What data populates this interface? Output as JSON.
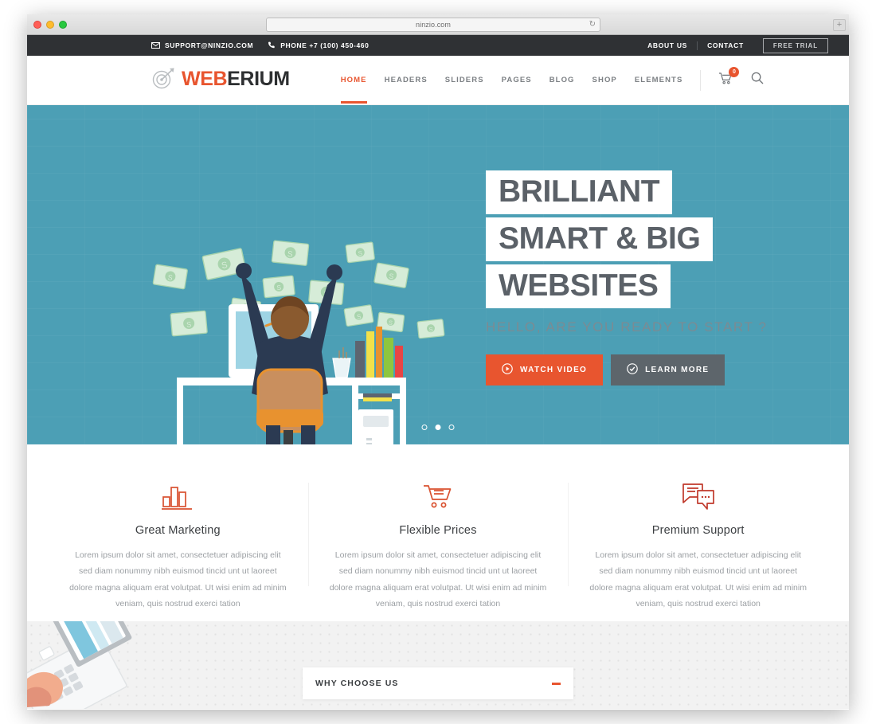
{
  "browser": {
    "url": "ninzio.com",
    "reload_icon": "reload-icon",
    "newtab_label": "+",
    "traffic_lights": [
      "close",
      "minimize",
      "maximize"
    ]
  },
  "topbar": {
    "email": "SUPPORT@NINZIO.COM",
    "email_icon": "envelope-icon",
    "phone": "PHONE +7 (100) 450-460",
    "phone_icon": "phone-icon",
    "links": [
      {
        "label": "ABOUT US"
      },
      {
        "label": "CONTACT"
      }
    ],
    "cta": "FREE TRIAL",
    "background": "#2f3134"
  },
  "header": {
    "logo": {
      "icon": "target-dart-icon",
      "text_part1": "WEB",
      "text_part2": "ERIUM",
      "color1": "#e8552f",
      "color2": "#2d2f31",
      "underline_color": "#bfe0e2"
    },
    "nav": [
      {
        "label": "HOME",
        "active": true
      },
      {
        "label": "HEADERS",
        "active": false
      },
      {
        "label": "SLIDERS",
        "active": false
      },
      {
        "label": "PAGES",
        "active": false
      },
      {
        "label": "BLOG",
        "active": false
      },
      {
        "label": "SHOP",
        "active": false
      },
      {
        "label": "ELEMENTS",
        "active": false
      }
    ],
    "cart_icon": "shopping-cart-icon",
    "cart_count": "0",
    "search_icon": "search-icon",
    "accent": "#e8552f"
  },
  "hero": {
    "headline_line1": "BRILLIANT",
    "headline_line2": "SMART & BIG",
    "headline_line3": "WEBSITES",
    "subtitle": "HELLO, ARE YOU READY TO START ?",
    "buttons": [
      {
        "label": "WATCH VIDEO",
        "icon": "play-circle-icon",
        "style": "primary"
      },
      {
        "label": "LEARN MORE",
        "icon": "check-circle-icon",
        "style": "secondary"
      }
    ],
    "background": "#4c9fb5",
    "slides": [
      {
        "active": false
      },
      {
        "active": true
      },
      {
        "active": false
      }
    ],
    "illustration": "businessman-money-desk-illustration"
  },
  "features": [
    {
      "icon": "bar-chart-icon",
      "title": "Great Marketing",
      "text": "Lorem ipsum dolor sit amet, consectetuer adipiscing elit sed diam nonummy nibh euismod tincid unt ut laoreet dolore magna aliquam erat volutpat. Ut wisi enim ad minim veniam, quis nostrud exerci tation"
    },
    {
      "icon": "shopping-cart-icon",
      "title": "Flexible Prices",
      "text": "Lorem ipsum dolor sit amet, consectetuer adipiscing elit sed diam nonummy nibh euismod tincid unt ut laoreet dolore magna aliquam erat volutpat. Ut wisi enim ad minim veniam, quis nostrud exerci tation"
    },
    {
      "icon": "chat-bubbles-icon",
      "title": "Premium Support",
      "text": "Lorem ipsum dolor sit amet, consectetuer adipiscing elit sed diam nonummy nibh euismod tincid unt ut laoreet dolore magna aliquam erat volutpat. Ut wisi enim ad minim veniam, quis nostrud exerci tation"
    }
  ],
  "why_section": {
    "accordion_title": "WHY CHOOSE US",
    "toggle_icon": "minus-icon",
    "toggle_color": "#e8552f",
    "illustration": "hand-laptop-illustration"
  }
}
